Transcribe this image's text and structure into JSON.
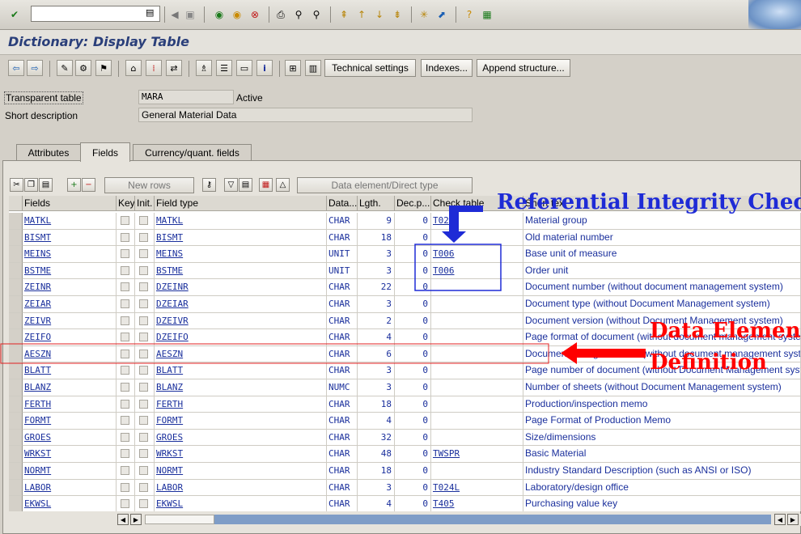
{
  "system_toolbar": {
    "command_field_value": "",
    "icons": [
      "enter-icon",
      "save-icon",
      "back-icon",
      "exit-icon",
      "cancel-icon",
      "print-icon",
      "find-icon",
      "find-next-icon",
      "first-page-icon",
      "prev-page-icon",
      "next-page-icon",
      "last-page-icon",
      "create-session-icon",
      "shortcut-icon",
      "help-icon",
      "layout-icon"
    ]
  },
  "page_title": "Dictionary: Display Table",
  "app_toolbar": {
    "technical_settings_label": "Technical settings",
    "indexes_label": "Indexes...",
    "append_structure_label": "Append structure..."
  },
  "header": {
    "table_type_label": "Transparent table",
    "table_name": "MARA",
    "status": "Active",
    "short_desc_label": "Short description",
    "short_desc_value": "General Material Data"
  },
  "tabs": [
    {
      "label": "Attributes",
      "active": false
    },
    {
      "label": "Fields",
      "active": true
    },
    {
      "label": "Currency/quant. fields",
      "active": false
    }
  ],
  "table_toolbar": {
    "new_rows_label": "New rows",
    "data_element_label": "Data element/Direct type"
  },
  "table": {
    "columns": [
      "Fields",
      "Key",
      "Init.",
      "Field type",
      "Data...",
      "Lgth.",
      "Dec.p...",
      "Check table",
      "Short text"
    ],
    "rows": [
      {
        "field": "MATKL",
        "type": "MATKL",
        "data": "CHAR",
        "len": "9",
        "dec": "0",
        "check": "T023",
        "text": "Material group"
      },
      {
        "field": "BISMT",
        "type": "BISMT",
        "data": "CHAR",
        "len": "18",
        "dec": "0",
        "check": "",
        "text": "Old material number"
      },
      {
        "field": "MEINS",
        "type": "MEINS",
        "data": "UNIT",
        "len": "3",
        "dec": "0",
        "check": "T006",
        "text": "Base unit of measure"
      },
      {
        "field": "BSTME",
        "type": "BSTME",
        "data": "UNIT",
        "len": "3",
        "dec": "0",
        "check": "T006",
        "text": "Order unit"
      },
      {
        "field": "ZEINR",
        "type": "DZEINR",
        "data": "CHAR",
        "len": "22",
        "dec": "0",
        "check": "",
        "text": "Document number (without document management system)"
      },
      {
        "field": "ZEIAR",
        "type": "DZEIAR",
        "data": "CHAR",
        "len": "3",
        "dec": "0",
        "check": "",
        "text": "Document type (without Document Management system)"
      },
      {
        "field": "ZEIVR",
        "type": "DZEIVR",
        "data": "CHAR",
        "len": "2",
        "dec": "0",
        "check": "",
        "text": "Document version (without Document Management system)"
      },
      {
        "field": "ZEIFO",
        "type": "DZEIFO",
        "data": "CHAR",
        "len": "4",
        "dec": "0",
        "check": "",
        "text": "Page format of document (without document management system)"
      },
      {
        "field": "AESZN",
        "type": "AESZN",
        "data": "CHAR",
        "len": "6",
        "dec": "0",
        "check": "",
        "text": "Document change number (without document management system)"
      },
      {
        "field": "BLATT",
        "type": "BLATT",
        "data": "CHAR",
        "len": "3",
        "dec": "0",
        "check": "",
        "text": "Page number of document (without Document Management system)"
      },
      {
        "field": "BLANZ",
        "type": "BLANZ",
        "data": "NUMC",
        "len": "3",
        "dec": "0",
        "check": "",
        "text": "Number of sheets (without Document Management system)"
      },
      {
        "field": "FERTH",
        "type": "FERTH",
        "data": "CHAR",
        "len": "18",
        "dec": "0",
        "check": "",
        "text": "Production/inspection memo"
      },
      {
        "field": "FORMT",
        "type": "FORMT",
        "data": "CHAR",
        "len": "4",
        "dec": "0",
        "check": "",
        "text": "Page Format of Production Memo"
      },
      {
        "field": "GROES",
        "type": "GROES",
        "data": "CHAR",
        "len": "32",
        "dec": "0",
        "check": "",
        "text": "Size/dimensions"
      },
      {
        "field": "WRKST",
        "type": "WRKST",
        "data": "CHAR",
        "len": "48",
        "dec": "0",
        "check": "TWSPR",
        "text": "Basic Material"
      },
      {
        "field": "NORMT",
        "type": "NORMT",
        "data": "CHAR",
        "len": "18",
        "dec": "0",
        "check": "",
        "text": "Industry Standard Description (such as ANSI or ISO)"
      },
      {
        "field": "LABOR",
        "type": "LABOR",
        "data": "CHAR",
        "len": "3",
        "dec": "0",
        "check": "T024L",
        "text": "Laboratory/design office"
      },
      {
        "field": "EKWSL",
        "type": "EKWSL",
        "data": "CHAR",
        "len": "4",
        "dec": "0",
        "check": "T405",
        "text": "Purchasing value key"
      }
    ]
  },
  "annotations": {
    "referential": "Referential Integrity Check",
    "data_element_1": "Data Element",
    "data_element_2": "Definition"
  },
  "colors": {
    "blue_annotation": "#1e2bd6",
    "red_annotation": "#ff0000",
    "link": "#1a2f9c",
    "title": "#2a3f7a"
  }
}
